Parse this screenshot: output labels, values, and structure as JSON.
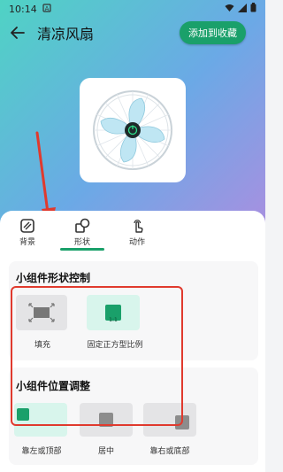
{
  "status_bar": {
    "time": "10:14"
  },
  "header": {
    "title": "清凉风扇",
    "favorite_button": "添加到收藏"
  },
  "tabs": [
    {
      "label": "背景",
      "icon": "background-icon"
    },
    {
      "label": "形状",
      "icon": "shape-icon",
      "active": true
    },
    {
      "label": "动作",
      "icon": "tap-action-icon"
    }
  ],
  "shape_control": {
    "title": "小组件形状控制",
    "options": [
      {
        "label": "填充",
        "selected": false
      },
      {
        "label": "固定正方型比例",
        "selected": true,
        "badge": "1:1"
      }
    ]
  },
  "position_control": {
    "title": "小组件位置调整",
    "options": [
      {
        "label": "靠左或顶部",
        "selected": true
      },
      {
        "label": "居中",
        "selected": false
      },
      {
        "label": "靠右或底部",
        "selected": false
      }
    ]
  },
  "colors": {
    "accent": "#1aa06a",
    "highlight": "#e03a2e"
  }
}
